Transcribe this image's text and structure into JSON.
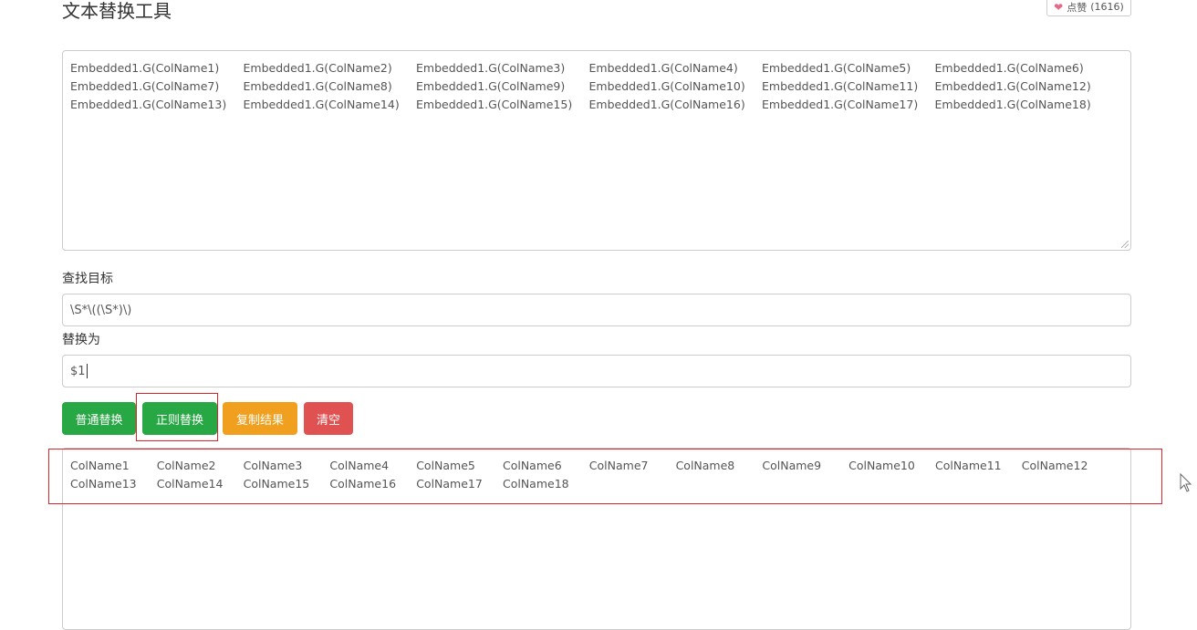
{
  "header": {
    "title": "文本替换工具",
    "like_label": "点赞",
    "like_count": "(1616)"
  },
  "source": {
    "rows": [
      [
        "Embedded1.G(ColName1)",
        "Embedded1.G(ColName2)",
        "Embedded1.G(ColName3)",
        "Embedded1.G(ColName4)",
        "Embedded1.G(ColName5)",
        "Embedded1.G(ColName6)"
      ],
      [
        "Embedded1.G(ColName7)",
        "Embedded1.G(ColName8)",
        "Embedded1.G(ColName9)",
        "Embedded1.G(ColName10)",
        "Embedded1.G(ColName11)",
        "Embedded1.G(ColName12)"
      ],
      [
        "Embedded1.G(ColName13)",
        "Embedded1.G(ColName14)",
        "Embedded1.G(ColName15)",
        "Embedded1.G(ColName16)",
        "Embedded1.G(ColName17)",
        "Embedded1.G(ColName18)"
      ]
    ]
  },
  "find": {
    "label": "查找目标",
    "value": "\\S*\\((\\S*)\\)"
  },
  "replace": {
    "label": "替换为",
    "value": "$1"
  },
  "buttons": {
    "normal_replace": "普通替换",
    "regex_replace": "正则替换",
    "copy_result": "复制结果",
    "clear": "清空"
  },
  "result": {
    "rows": [
      [
        "ColName1",
        "ColName2",
        "ColName3",
        "ColName4",
        "ColName5",
        "ColName6",
        "ColName7",
        "ColName8",
        "ColName9",
        "ColName10",
        "ColName11",
        "ColName12"
      ],
      [
        "ColName13",
        "ColName14",
        "ColName15",
        "ColName16",
        "ColName17",
        "ColName18"
      ]
    ]
  },
  "colors": {
    "green": "#28a745",
    "orange": "#f0a01e",
    "red": "#e05252",
    "highlight": "#e0222a"
  }
}
